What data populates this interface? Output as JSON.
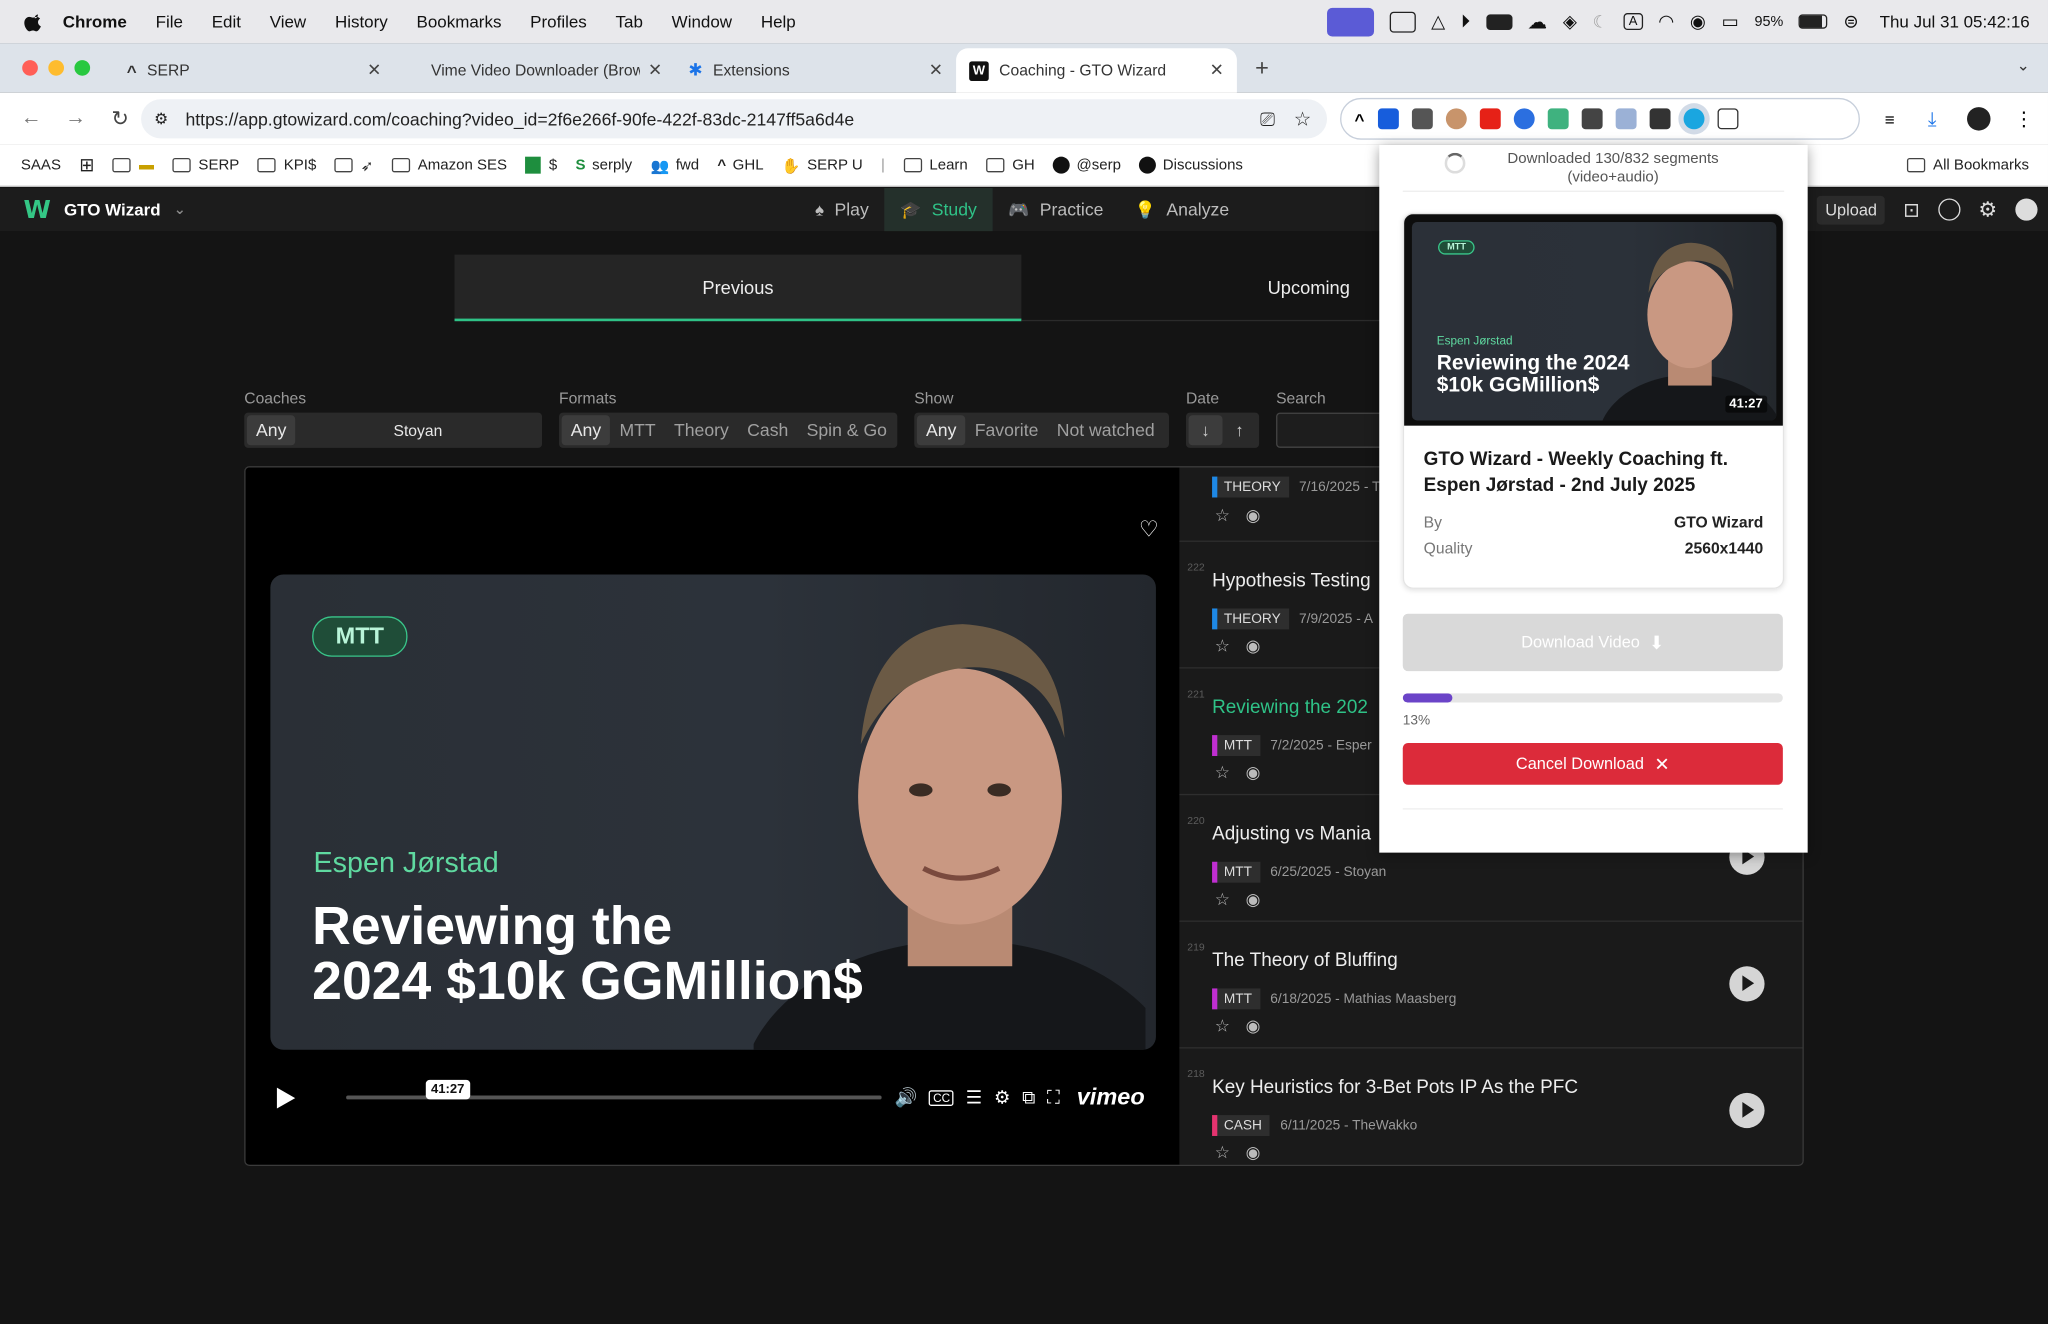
{
  "menubar": {
    "app": "Chrome",
    "items": [
      "File",
      "Edit",
      "View",
      "History",
      "Bookmarks",
      "Profiles",
      "Tab",
      "Window",
      "Help"
    ],
    "battery": "95%",
    "clock": "Thu Jul 31  05:42:16"
  },
  "tabs": [
    {
      "title": "SERP",
      "active": false
    },
    {
      "title": "Vime Video Downloader (Brow",
      "active": false
    },
    {
      "title": "Extensions",
      "active": false
    },
    {
      "title": "Coaching - GTO Wizard",
      "active": true
    }
  ],
  "address": {
    "url": "https://app.gtowizard.com/coaching?video_id=2f6e266f-90fe-422f-83dc-2147ff5a6d4e"
  },
  "bookmarks": [
    "SAAS",
    "",
    "",
    "SERP",
    "KPI$",
    "",
    "Amazon SES",
    "$",
    "serply",
    "fwd",
    "GHL",
    "SERP U",
    "Learn",
    "GH",
    "@serp",
    "Discussions"
  ],
  "bookmarks_all": "All Bookmarks",
  "app": {
    "brand": "GTO Wizard",
    "nav": [
      {
        "label": "Play",
        "icon": "spade-icon"
      },
      {
        "label": "Study",
        "icon": "grad-cap-icon",
        "active": true
      },
      {
        "label": "Practice",
        "icon": "gamepad-icon"
      },
      {
        "label": "Analyze",
        "icon": "bulb-icon"
      }
    ],
    "upload": "Upload"
  },
  "switch": {
    "previous": "Previous",
    "upcoming": "Upcoming"
  },
  "filters": {
    "coaches_label": "Coaches",
    "coaches_any": "Any",
    "coaches_value": "Stoyan",
    "formats_label": "Formats",
    "formats": [
      "Any",
      "MTT",
      "Theory",
      "Cash",
      "Spin & Go"
    ],
    "show_label": "Show",
    "show": [
      "Any",
      "Favorite",
      "Not watched"
    ],
    "date_label": "Date",
    "search_label": "Search"
  },
  "player": {
    "tag": "MTT",
    "coach": "Espen Jørstad",
    "title_line1": "Reviewing the",
    "title_line2": "2024 $10k GGMillion$",
    "time": "41:27",
    "brand": "vimeo"
  },
  "videos": [
    {
      "num": "",
      "title": "",
      "tag": "THEORY",
      "meta": "7/16/2025 - T"
    },
    {
      "num": "222",
      "title": "Hypothesis Testing",
      "tag": "THEORY",
      "meta": "7/9/2025 - A"
    },
    {
      "num": "221",
      "title": "Reviewing the 202",
      "tag": "MTT",
      "meta": "7/2/2025 - Esper",
      "current": true
    },
    {
      "num": "220",
      "title": "Adjusting vs Mania",
      "tag": "MTT",
      "meta": "6/25/2025 - Stoyan"
    },
    {
      "num": "219",
      "title": "The Theory of Bluffing",
      "tag": "MTT",
      "meta": "6/18/2025 - Mathias Maasberg"
    },
    {
      "num": "218",
      "title": "Key Heuristics for 3-Bet Pots IP As the PFC",
      "tag": "CASH",
      "meta": "6/11/2025 - TheWakko"
    }
  ],
  "tag_colors": {
    "THEORY": "#1e88e5",
    "MTT": "#c02ed1",
    "CASH": "#e5336f"
  },
  "downloader": {
    "status": "Downloaded 130/832 segments (video+audio)",
    "thumb_tag": "MTT",
    "thumb_coach": "Espen Jørstad",
    "thumb_title": "Reviewing the 2024 $10k GGMillion$",
    "thumb_duration": "41:27",
    "title": "GTO Wizard - Weekly Coaching ft. Espen Jørstad - 2nd July 2025",
    "by_label": "By",
    "by_value": "GTO Wizard",
    "quality_label": "Quality",
    "quality_value": "2560x1440",
    "download_label": "Download Video",
    "progress": 0.13,
    "progress_text": "13%",
    "cancel_label": "Cancel Download"
  }
}
